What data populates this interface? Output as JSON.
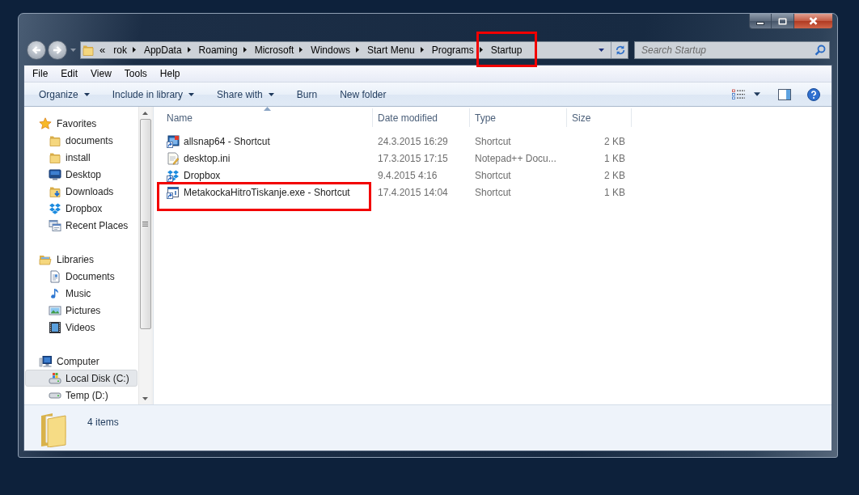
{
  "navigation": {
    "back": {
      "disabled": true
    },
    "forward": {
      "disabled": true
    }
  },
  "address_bar": {
    "overflow": "«",
    "segments": [
      {
        "label": "rok",
        "highlighted": false
      },
      {
        "label": "AppData",
        "highlighted": false
      },
      {
        "label": "Roaming",
        "highlighted": false
      },
      {
        "label": "Microsoft",
        "highlighted": false
      },
      {
        "label": "Windows",
        "highlighted": false
      },
      {
        "label": "Start Menu",
        "highlighted": false
      },
      {
        "label": "Programs",
        "highlighted": false
      },
      {
        "label": "Startup",
        "highlighted": true
      }
    ]
  },
  "search": {
    "placeholder": "Search Startup"
  },
  "menu_bar": [
    "File",
    "Edit",
    "View",
    "Tools",
    "Help"
  ],
  "command_bar": {
    "buttons": [
      {
        "label": "Organize",
        "dropdown": true
      },
      {
        "label": "Include in library",
        "dropdown": true
      },
      {
        "label": "Share with",
        "dropdown": true
      },
      {
        "label": "Burn",
        "dropdown": false
      },
      {
        "label": "New folder",
        "dropdown": false
      }
    ]
  },
  "navigation_pane": {
    "groups": [
      {
        "label": "Favorites",
        "kind": "favorites",
        "selected": false,
        "children": [
          {
            "label": "documents",
            "kind": "folder",
            "selected": false
          },
          {
            "label": "install",
            "kind": "folder",
            "selected": false
          },
          {
            "label": "Desktop",
            "kind": "desktop",
            "selected": false
          },
          {
            "label": "Downloads",
            "kind": "downloads",
            "selected": false
          },
          {
            "label": "Dropbox",
            "kind": "dropbox",
            "selected": false
          },
          {
            "label": "Recent Places",
            "kind": "recent",
            "selected": false
          }
        ]
      },
      {
        "label": "Libraries",
        "kind": "libraries",
        "selected": false,
        "children": [
          {
            "label": "Documents",
            "kind": "documents",
            "selected": false
          },
          {
            "label": "Music",
            "kind": "music",
            "selected": false
          },
          {
            "label": "Pictures",
            "kind": "pictures",
            "selected": false
          },
          {
            "label": "Videos",
            "kind": "videos",
            "selected": false
          }
        ]
      },
      {
        "label": "Computer",
        "kind": "computer",
        "selected": false,
        "children": [
          {
            "label": "Local Disk (C:)",
            "kind": "sysdrive",
            "selected": true
          },
          {
            "label": "Temp (D:)",
            "kind": "drive",
            "selected": false
          }
        ]
      }
    ]
  },
  "file_list": {
    "columns": [
      {
        "label": "Name",
        "sorted": true
      },
      {
        "label": "Date modified",
        "sorted": false
      },
      {
        "label": "Type",
        "sorted": false
      },
      {
        "label": "Size",
        "sorted": false
      }
    ],
    "rows": [
      {
        "kind": "appshortcut",
        "name": "allsnap64 - Shortcut",
        "date_modified": "24.3.2015 16:29",
        "type": "Shortcut",
        "size": "2 KB",
        "highlighted": false
      },
      {
        "kind": "textfile",
        "name": "desktop.ini",
        "date_modified": "17.3.2015 17:15",
        "type": "Notepad++ Docu...",
        "size": "1 KB",
        "highlighted": false
      },
      {
        "kind": "boxshortcut",
        "name": "Dropbox",
        "date_modified": "9.4.2015 4:16",
        "type": "Shortcut",
        "size": "2 KB",
        "highlighted": false
      },
      {
        "kind": "exeshortcut",
        "name": "MetakockaHitroTiskanje.exe - Shortcut",
        "date_modified": "17.4.2015 14:04",
        "type": "Shortcut",
        "size": "1 KB",
        "highlighted": true
      }
    ]
  },
  "status_bar": {
    "item_count": "4 items"
  }
}
